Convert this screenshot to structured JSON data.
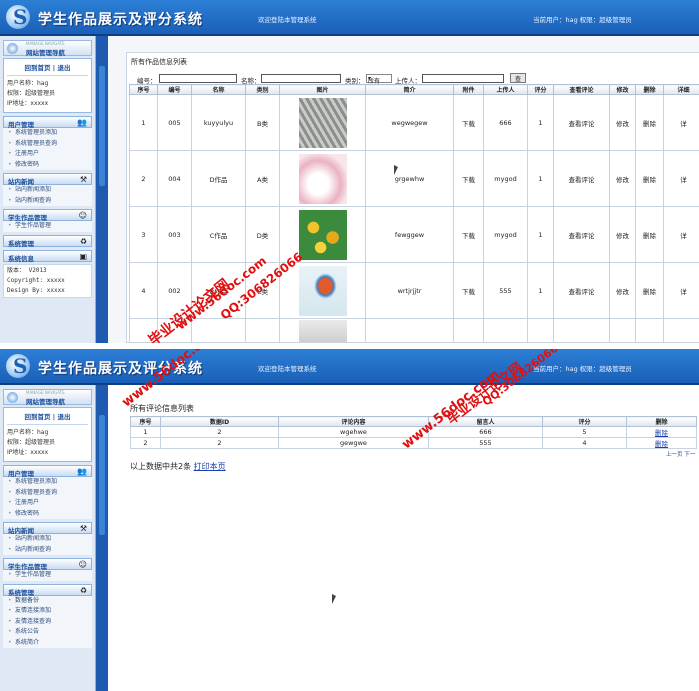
{
  "app": {
    "title": "学生作品展示及评分系统",
    "welcome": "欢迎登陆本管理系统",
    "current_user": "当前用户：hag 权限：超级管理员"
  },
  "sidebar": {
    "nav_title": "网站管理导航",
    "nav_subtitle": "MANAGE NAVIGATE",
    "links": "回到首页 | 退出",
    "user_name": "用户名称：hag",
    "role": "权限：超级管理员",
    "ip": "IP地址：xxxxx",
    "groups": {
      "user_mgmt": "用户管理",
      "news": "站内新闻",
      "works": "学生作品管理",
      "system": "系统管理",
      "sysinfo": "系统信息"
    },
    "user_items": [
      "系统管理员添加",
      "系统管理员查询",
      "注册用户",
      "修改密码"
    ],
    "news_items": [
      "站内新闻添加",
      "站内新闻查询"
    ],
    "works_items": [
      "学生作品管理"
    ],
    "system_items": [
      "数据备份",
      "友情连接添加",
      "友情连接查询",
      "系统公告",
      "系统简介"
    ],
    "version_lines": [
      "版本： V2013",
      "Copyright: xxxxx",
      "Design By:  xxxxx"
    ]
  },
  "screen1": {
    "panel_title": "所有作品信息列表",
    "search": {
      "id_label": "编号：",
      "name_label": "名称：",
      "category_label": "类别：",
      "category_value": "所有",
      "uploader_label": "上传人：",
      "button": "查找"
    },
    "columns": [
      "序号",
      "编号",
      "名称",
      "类别",
      "图片",
      "简介",
      "附件",
      "上传人",
      "评分",
      "查看评论",
      "修改",
      "删除",
      "详细"
    ],
    "rows": [
      {
        "seq": "1",
        "id": "005",
        "name": "kuyyulyu",
        "cat": "B类",
        "img": "p-ink",
        "intro": "wegwegew",
        "attach": "下载",
        "uploader": "666",
        "score": "1",
        "view": "查看评论",
        "edit": "修改",
        "del": "删除",
        "detail": "详"
      },
      {
        "seq": "2",
        "id": "004",
        "name": "D作品",
        "cat": "A类",
        "img": "p-swan",
        "intro": "grgewhw",
        "attach": "下载",
        "uploader": "mygod",
        "score": "1",
        "view": "查看评论",
        "edit": "修改",
        "del": "删除",
        "detail": "详"
      },
      {
        "seq": "3",
        "id": "003",
        "name": "C作品",
        "cat": "D类",
        "img": "p-flower",
        "intro": "fewggew",
        "attach": "下载",
        "uploader": "mygod",
        "score": "1",
        "view": "查看评论",
        "edit": "修改",
        "del": "删除",
        "detail": "详"
      },
      {
        "seq": "4",
        "id": "002",
        "name": "B作品",
        "cat": "C类",
        "img": "p-fish",
        "intro": "wrtjrjjtr",
        "attach": "下载",
        "uploader": "555",
        "score": "1",
        "view": "查看评论",
        "edit": "修改",
        "del": "删除",
        "detail": "详"
      },
      {
        "seq": "",
        "id": "",
        "name": "",
        "cat": "",
        "img": "p-blank",
        "intro": "",
        "attach": "",
        "uploader": "",
        "score": "",
        "view": "",
        "edit": "",
        "del": "",
        "detail": ""
      }
    ]
  },
  "screen2": {
    "panel_title": "所有评论信息列表",
    "columns": [
      "序号",
      "数据ID",
      "评论内容",
      "留言人",
      "评分",
      "删除"
    ],
    "rows": [
      {
        "seq": "1",
        "id": "2",
        "content": "wgehwe",
        "user": "666",
        "score": "5",
        "del": "删除"
      },
      {
        "seq": "2",
        "id": "2",
        "content": "gewgwe",
        "user": "555",
        "score": "4",
        "del": "删除"
      }
    ],
    "pager": "上一页  下一",
    "summary": "以上数据中共2条",
    "print": "打印本页"
  },
  "watermark": {
    "site": "www.56doc.com",
    "qq": "QQ:306826066",
    "name": "毕业设计论文网"
  }
}
